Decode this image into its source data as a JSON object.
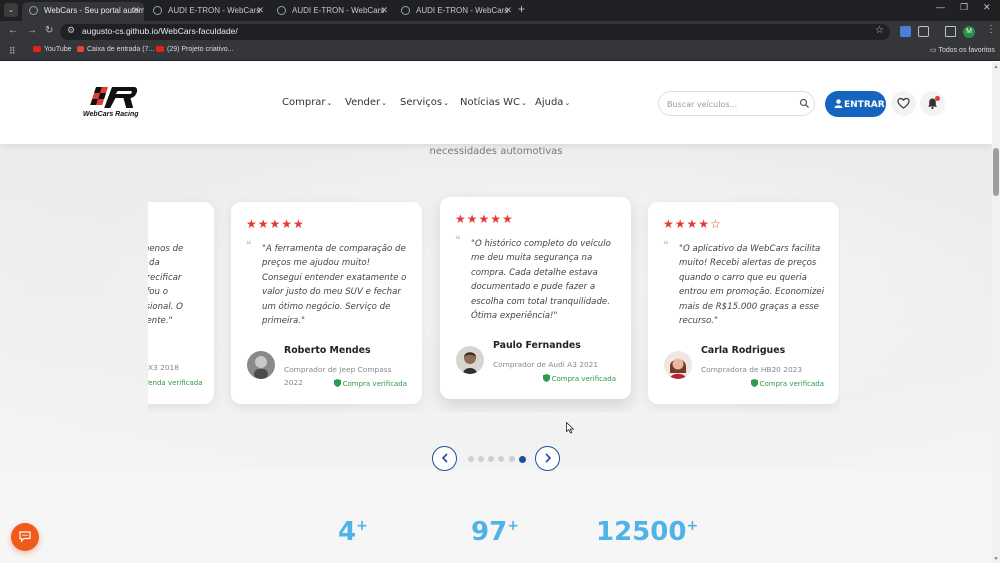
{
  "browser": {
    "tabs": [
      {
        "title": "WebCars - Seu portal automot",
        "active": true
      },
      {
        "title": "AUDI E-TRON - WebCars",
        "active": false
      },
      {
        "title": "AUDI E-TRON - WebCars",
        "active": false
      },
      {
        "title": "AUDI E-TRON - WebCars",
        "active": false
      }
    ],
    "url": "augusto-cs.github.io/WebCars-faculdade/",
    "profile_initial": "M",
    "bookmarks": [
      {
        "label": "YouTube"
      },
      {
        "label": "Caixa de entrada (7..."
      },
      {
        "label": "(29) Projeto criativo..."
      }
    ],
    "all_bookmarks": "Todos os favoritos"
  },
  "header": {
    "logo_text": "WebCars Racing",
    "nav": [
      {
        "label": "Comprar"
      },
      {
        "label": "Vender"
      },
      {
        "label": "Serviços"
      },
      {
        "label": "Notícias WC"
      },
      {
        "label": "Ajuda"
      }
    ],
    "search_placeholder": "Buscar veículos...",
    "login_label": "ENTRAR"
  },
  "section": {
    "subtitle": "necessidades automotivas"
  },
  "testimonials": [
    {
      "stars": 5,
      "quote_lines": [
        "menos de",
        "e da",
        "precificar",
        "afou o",
        "ssional. O",
        "dente.\""
      ],
      "role": "X3 2018",
      "verified": "Venda verificada"
    },
    {
      "stars": 5,
      "quote": "\"A ferramenta de comparação de preços me ajudou muito! Consegui entender exatamente o valor justo do meu SUV e fechar um ótimo negócio. Serviço de primeira.\"",
      "author": "Roberto Mendes",
      "role": "Comprador de Jeep Compass 2022",
      "verified": "Compra verificada"
    },
    {
      "stars": 5,
      "quote": "\"O histórico completo do veículo me deu muita segurança na compra. Cada detalhe estava documentado e pude fazer a escolha com total tranquilidade. Ótima experiência!\"",
      "author": "Paulo Fernandes",
      "role": "Comprador de Audi A3 2021",
      "verified": "Compra verificada"
    },
    {
      "stars": 4,
      "quote": "\"O aplicativo da WebCars facilita muito! Recebi alertas de preços quando o carro que eu queria entrou em promoção. Economizei mais de R$15.000 graças a esse recurso.\"",
      "author": "Carla Rodrigues",
      "role": "Compradora de HB20 2023",
      "verified": "Compra verificada"
    }
  ],
  "carousel": {
    "prev_icon": "chevron-left-icon",
    "next_icon": "chevron-right-icon",
    "dot_count": 6,
    "active_dot": 6
  },
  "stats": [
    {
      "value": "4",
      "suffix": "+"
    },
    {
      "value": "97",
      "suffix": "+"
    },
    {
      "value": "12500",
      "suffix": "+"
    }
  ],
  "colors": {
    "primary": "#1565c0",
    "star": "#e53935",
    "verified": "#2e9a4a",
    "stat": "#4fb3e8",
    "chat": "#f05a1a"
  }
}
